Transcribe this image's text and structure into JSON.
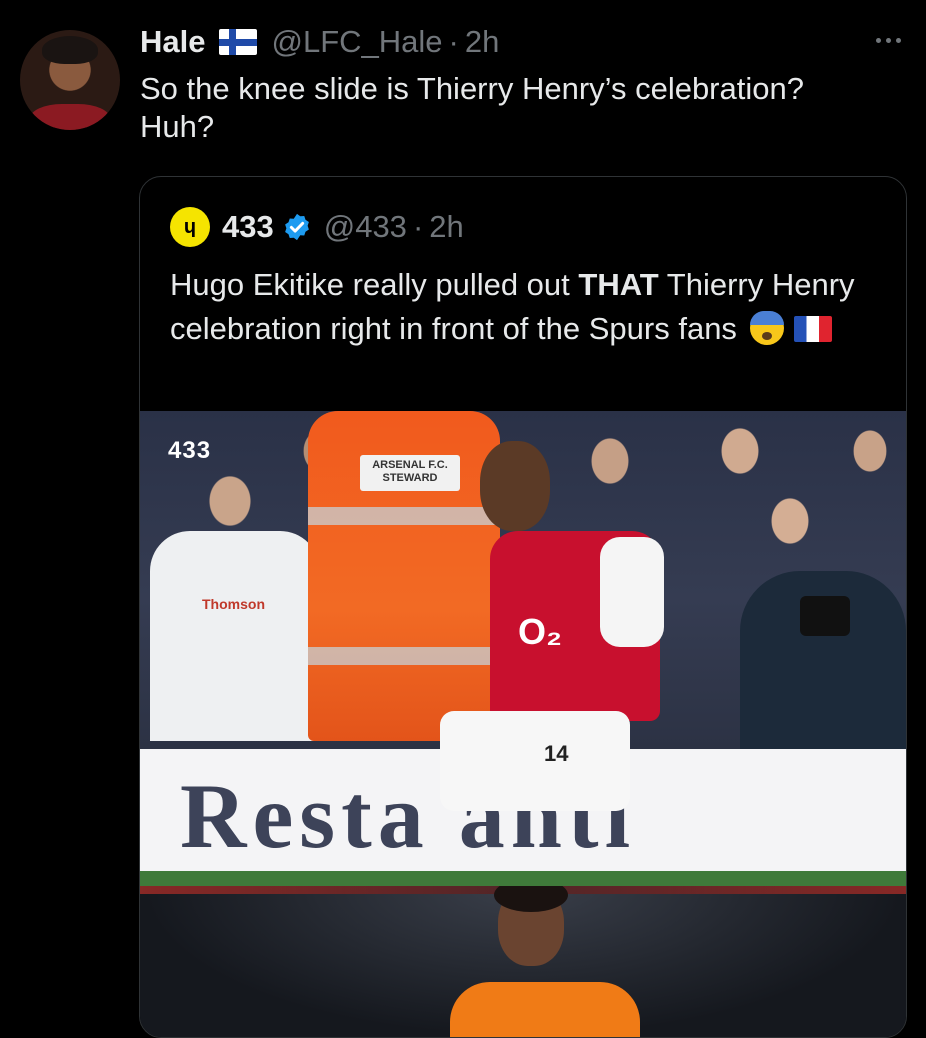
{
  "tweet": {
    "author_name": "Hale",
    "author_flag": "finland-flag-icon",
    "handle": "@LFC_Hale",
    "separator": "·",
    "time": "2h",
    "text_line1": "So the knee slide is Thierry Henry’s celebration?",
    "text_line2": "Huh?"
  },
  "quote": {
    "logo_label": "ɥ",
    "author_name": "433",
    "handle": "@433",
    "separator": "·",
    "time": "2h",
    "text_pre": "Hugo Ekitike really pulled out ",
    "text_bold": "THAT",
    "text_post": " Thierry Henry celebration right in front of the Spurs fans",
    "emojis": [
      "anxious-face-icon",
      "france-flag-icon"
    ]
  },
  "media": {
    "watermark": "433",
    "steward_badge": "ARSENAL F.C. STEWARD",
    "shirt_sponsor_fan": "Thomson",
    "shirt_sponsor_player": "O₂",
    "shirt_number": "14",
    "hoarding_text": "Resta   anti"
  },
  "colors": {
    "background": "#000000",
    "text": "#e7e9ea",
    "muted": "#71767b",
    "border": "#2f3336",
    "verified": "#1d9bf0",
    "brand_433": "#f5e400"
  }
}
